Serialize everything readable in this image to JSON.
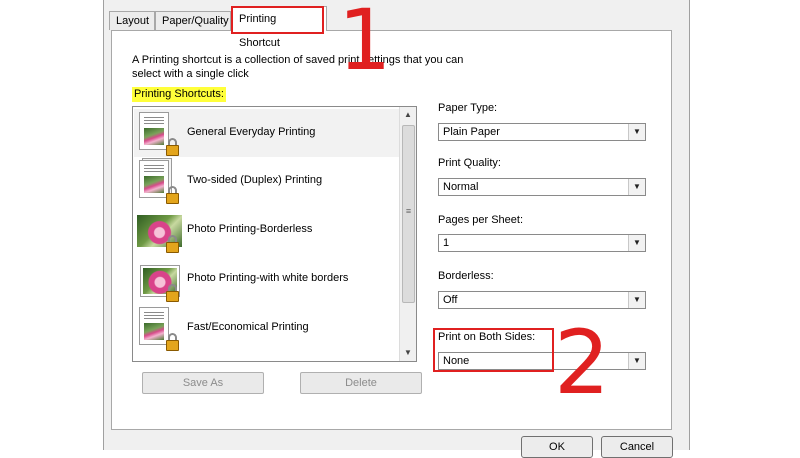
{
  "tabs": [
    {
      "label": "Layout"
    },
    {
      "label": "Paper/Quality"
    },
    {
      "label": "Printing Shortcut"
    }
  ],
  "intro_text": "A Printing shortcut is a collection of saved print settings that you can select with a single click",
  "shortcuts_label": "Printing Shortcuts:",
  "shortcuts": [
    {
      "label": "General Everyday Printing",
      "icon": "document-icon",
      "selected": true
    },
    {
      "label": "Two-sided (Duplex) Printing",
      "icon": "duplex-document-icon"
    },
    {
      "label": "Photo Printing-Borderless",
      "icon": "photo-icon"
    },
    {
      "label": "Photo Printing-with white borders",
      "icon": "bordered-photo-icon"
    },
    {
      "label": "Fast/Economical Printing",
      "icon": "document-icon"
    }
  ],
  "buttons": {
    "save_as": "Save As",
    "delete": "Delete",
    "ok": "OK",
    "cancel": "Cancel"
  },
  "settings": {
    "paper_type": {
      "label": "Paper Type:",
      "value": "Plain Paper"
    },
    "print_quality": {
      "label": "Print Quality:",
      "value": "Normal"
    },
    "pages_per_sheet": {
      "label": "Pages per Sheet:",
      "value": "1"
    },
    "borderless": {
      "label": "Borderless:",
      "value": "Off"
    },
    "both_sides": {
      "label": "Print on Both Sides:",
      "value": "None"
    }
  },
  "annotations": {
    "one": "1",
    "two": "2",
    "color": "#e02020"
  },
  "highlight_color": "#ffff3a"
}
